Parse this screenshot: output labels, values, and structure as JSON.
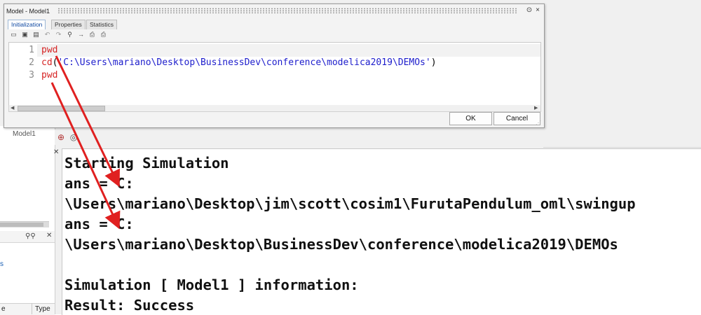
{
  "dialog": {
    "title": "Model - Model1",
    "title_buttons": [
      "⊙",
      "×"
    ],
    "tabs": [
      {
        "label": "Initialization",
        "active": true
      },
      {
        "label": "Properties",
        "active": false
      },
      {
        "label": "Statistics",
        "active": false
      }
    ],
    "toolbar_icons": [
      "open-icon",
      "save-icon",
      "save-as-icon",
      "undo-icon",
      "redo-icon",
      "find-icon",
      "goto-icon",
      "print-preview-icon",
      "print-icon"
    ],
    "editor": {
      "line_numbers": [
        "1",
        "2",
        "3"
      ],
      "lines": [
        {
          "cmd": "pwd",
          "rest_open": "",
          "arg": "",
          "rest_close": ""
        },
        {
          "cmd": "cd",
          "rest_open": "(",
          "arg": "'C:\\Users\\mariano\\Desktop\\BusinessDev\\conference\\modelica2019\\DEMOs'",
          "rest_close": ")"
        },
        {
          "cmd": "pwd",
          "rest_open": "",
          "arg": "",
          "rest_close": ""
        }
      ]
    },
    "ok_label": "OK",
    "cancel_label": "Cancel"
  },
  "background": {
    "model_label": "Model1",
    "left_item_marker": "s",
    "bottom_columns": [
      "e",
      "Type"
    ]
  },
  "console": {
    "lines": [
      "Starting Simulation",
      "ans = C:",
      "\\Users\\mariano\\Desktop\\jim\\scott\\cosim1\\FurutaPendulum_oml\\swingup",
      "ans = C:",
      "\\Users\\mariano\\Desktop\\BusinessDev\\conference\\modelica2019\\DEMOs",
      "",
      "Simulation [ Model1 ] information:",
      "Result: Success"
    ]
  },
  "colors": {
    "keyword": "#d62424",
    "string": "#1d1dcc",
    "annotation_arrow": "#e02020"
  }
}
